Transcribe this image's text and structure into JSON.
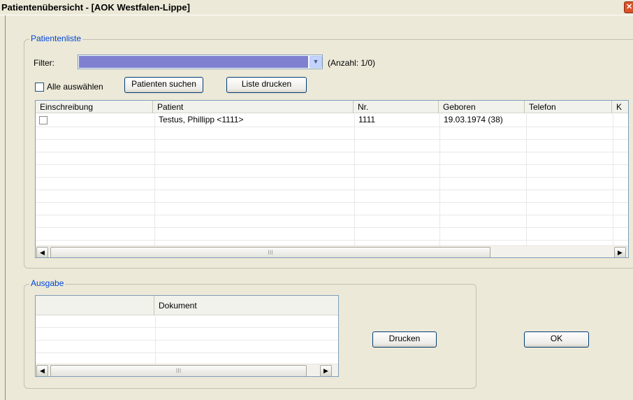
{
  "window": {
    "title": "Patientenübersicht - [AOK Westfalen-Lippe]",
    "close_glyph": "✕"
  },
  "patientenliste": {
    "group_label": "Patientenliste",
    "filter_label": "Filter:",
    "filter_value": "",
    "count_text": "(Anzahl: 1/0)",
    "select_all_label": "Alle auswählen",
    "search_button": "Patienten suchen",
    "print_list_button": "Liste drucken",
    "columns": [
      "Einschreibung",
      "Patient",
      "Nr.",
      "Geboren",
      "Telefon",
      "K"
    ],
    "rows": [
      {
        "einschreibung": "",
        "patient": "Testus,  Phillipp <1111>",
        "nr": "1111",
        "geboren": "19.03.1974 (38)",
        "telefon": "",
        "k": ""
      }
    ],
    "scroll_grip": "III"
  },
  "ausgabe": {
    "group_label": "Ausgabe",
    "columns": [
      "",
      "Dokument"
    ],
    "scroll_grip": "III",
    "print_button": "Drucken"
  },
  "ok_button": "OK",
  "colors": {
    "group_label": "#0046d5",
    "filter_selection": "#8080d0",
    "dialog_background": "#ece9d8"
  }
}
